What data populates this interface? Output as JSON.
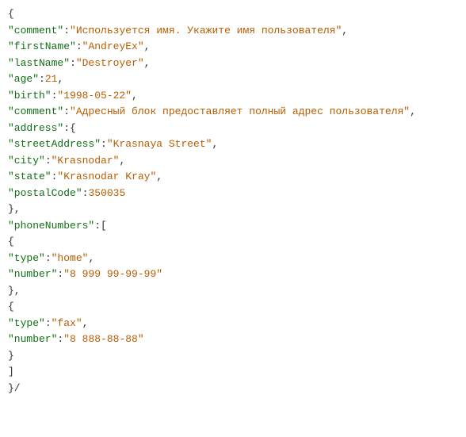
{
  "code_lines": [
    [
      {
        "c": "punct",
        "t": "{"
      }
    ],
    [
      {
        "c": "key",
        "t": "\"comment\""
      },
      {
        "c": "punct",
        "t": ":"
      },
      {
        "c": "str",
        "t": "\"Используется имя. Укажите имя пользователя\""
      },
      {
        "c": "punct",
        "t": ","
      }
    ],
    [
      {
        "c": "key",
        "t": "\"firstName\""
      },
      {
        "c": "punct",
        "t": ":"
      },
      {
        "c": "str",
        "t": "\"AndreyEx\""
      },
      {
        "c": "punct",
        "t": ","
      }
    ],
    [
      {
        "c": "key",
        "t": "\"lastName\""
      },
      {
        "c": "punct",
        "t": ":"
      },
      {
        "c": "str",
        "t": "\"Destroyer\""
      },
      {
        "c": "punct",
        "t": ","
      }
    ],
    [
      {
        "c": "key",
        "t": "\"age\""
      },
      {
        "c": "punct",
        "t": ":"
      },
      {
        "c": "num",
        "t": "21"
      },
      {
        "c": "punct",
        "t": ","
      }
    ],
    [
      {
        "c": "key",
        "t": "\"birth\""
      },
      {
        "c": "punct",
        "t": ":"
      },
      {
        "c": "str",
        "t": "\"1998-05-22\""
      },
      {
        "c": "punct",
        "t": ","
      }
    ],
    [
      {
        "c": "key",
        "t": "\"comment\""
      },
      {
        "c": "punct",
        "t": ":"
      },
      {
        "c": "str",
        "t": "\"Адресный блок предоставляет полный адрес пользователя\""
      },
      {
        "c": "punct",
        "t": ","
      }
    ],
    [
      {
        "c": "key",
        "t": "\"address\""
      },
      {
        "c": "punct",
        "t": ":{"
      }
    ],
    [
      {
        "c": "key",
        "t": "\"streetAddress\""
      },
      {
        "c": "punct",
        "t": ":"
      },
      {
        "c": "str",
        "t": "\"Krasnaya Street\""
      },
      {
        "c": "punct",
        "t": ","
      }
    ],
    [
      {
        "c": "key",
        "t": "\"city\""
      },
      {
        "c": "punct",
        "t": ":"
      },
      {
        "c": "str",
        "t": "\"Krasnodar\""
      },
      {
        "c": "punct",
        "t": ","
      }
    ],
    [
      {
        "c": "key",
        "t": "\"state\""
      },
      {
        "c": "punct",
        "t": ":"
      },
      {
        "c": "str",
        "t": "\"Krasnodar Kray\""
      },
      {
        "c": "punct",
        "t": ","
      }
    ],
    [
      {
        "c": "key",
        "t": "\"postalCode\""
      },
      {
        "c": "punct",
        "t": ":"
      },
      {
        "c": "num",
        "t": "350035"
      }
    ],
    [
      {
        "c": "punct",
        "t": "},"
      }
    ],
    [
      {
        "c": "key",
        "t": "\"phoneNumbers\""
      },
      {
        "c": "punct",
        "t": ":["
      }
    ],
    [
      {
        "c": "punct",
        "t": "{"
      }
    ],
    [
      {
        "c": "key",
        "t": "\"type\""
      },
      {
        "c": "punct",
        "t": ":"
      },
      {
        "c": "str",
        "t": "\"home\""
      },
      {
        "c": "punct",
        "t": ","
      }
    ],
    [
      {
        "c": "key",
        "t": "\"number\""
      },
      {
        "c": "punct",
        "t": ":"
      },
      {
        "c": "str",
        "t": "\"8 999 99-99-99\""
      }
    ],
    [
      {
        "c": "punct",
        "t": "},"
      }
    ],
    [
      {
        "c": "punct",
        "t": "{"
      }
    ],
    [
      {
        "c": "key",
        "t": "\"type\""
      },
      {
        "c": "punct",
        "t": ":"
      },
      {
        "c": "str",
        "t": "\"fax\""
      },
      {
        "c": "punct",
        "t": ","
      }
    ],
    [
      {
        "c": "key",
        "t": "\"number\""
      },
      {
        "c": "punct",
        "t": ":"
      },
      {
        "c": "str",
        "t": "\"8 888-88-88\""
      }
    ],
    [
      {
        "c": "punct",
        "t": "}"
      }
    ],
    [
      {
        "c": "punct",
        "t": "]"
      }
    ],
    [
      {
        "c": "punct",
        "t": "}/"
      }
    ]
  ]
}
